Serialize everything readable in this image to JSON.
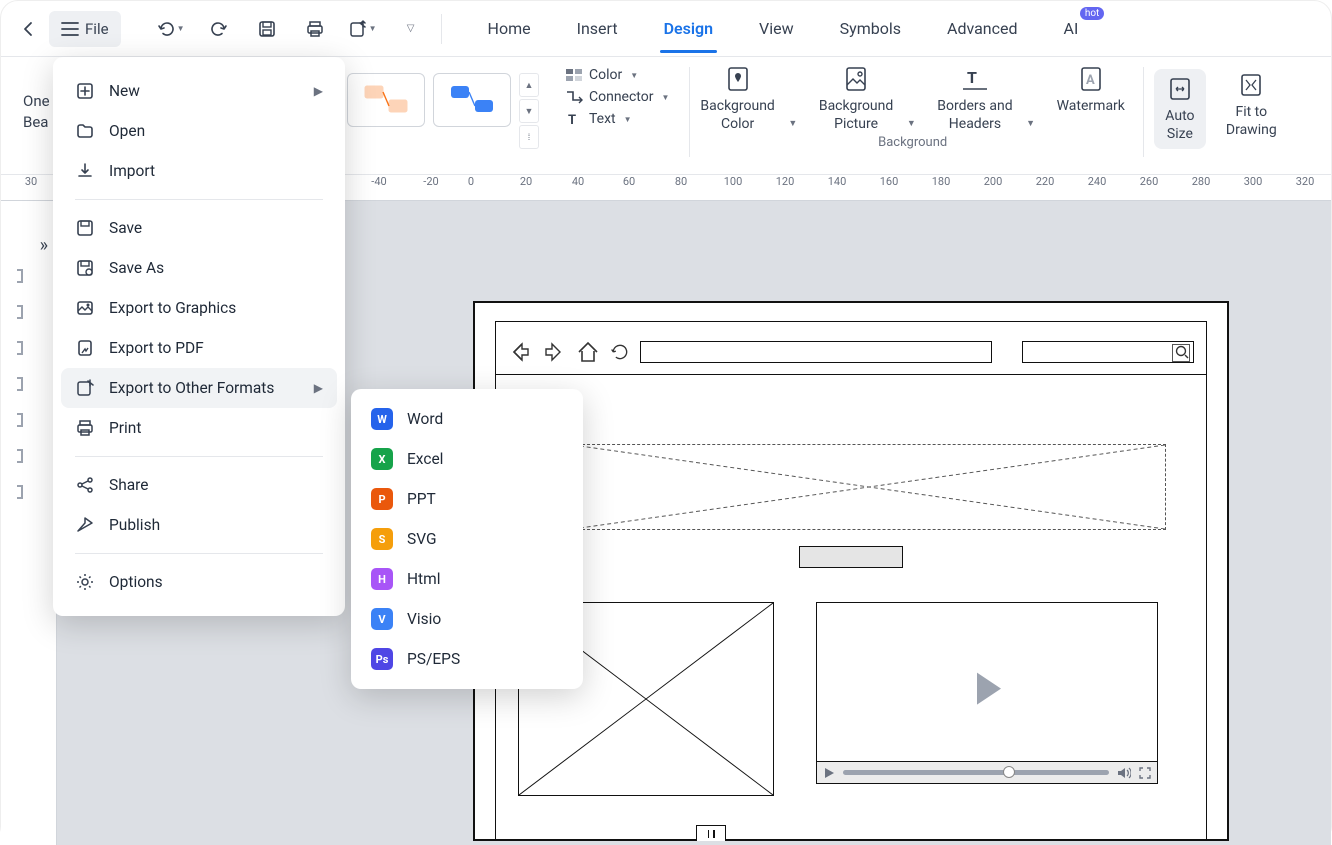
{
  "toolbar": {
    "file_label": "File"
  },
  "tabs": {
    "home": "Home",
    "insert": "Insert",
    "design": "Design",
    "view": "View",
    "symbols": "Symbols",
    "advanced": "Advanced",
    "ai": "AI",
    "ai_badge": "hot"
  },
  "ribbon": {
    "left_hidden_line1": "One",
    "left_hidden_line2": "Bea",
    "color": "Color",
    "connector": "Connector",
    "text": "Text",
    "bg_color": "Background Color",
    "bg_picture": "Background Picture",
    "borders_headers": "Borders and Headers",
    "watermark": "Watermark",
    "bg_group": "Background",
    "auto_size": "Auto Size",
    "fit_drawing": "Fit to Drawing"
  },
  "ruler": [
    "30",
    "",
    "",
    "",
    "",
    "-40",
    "-20",
    "0",
    "20",
    "40",
    "60",
    "80",
    "100",
    "120",
    "140",
    "160",
    "180",
    "200",
    "220",
    "240",
    "260",
    "280",
    "300",
    "320"
  ],
  "file_menu": {
    "new": "New",
    "open": "Open",
    "import": "Import",
    "save": "Save",
    "save_as": "Save As",
    "export_graphics": "Export to Graphics",
    "export_pdf": "Export to PDF",
    "export_other": "Export to Other Formats",
    "print": "Print",
    "share": "Share",
    "publish": "Publish",
    "options": "Options"
  },
  "export_formats": {
    "word": {
      "label": "Word",
      "color": "#2563eb",
      "glyph": "W"
    },
    "excel": {
      "label": "Excel",
      "color": "#16a34a",
      "glyph": "X"
    },
    "ppt": {
      "label": "PPT",
      "color": "#ea580c",
      "glyph": "P"
    },
    "svg": {
      "label": "SVG",
      "color": "#f59e0b",
      "glyph": "S"
    },
    "html": {
      "label": "Html",
      "color": "#a855f7",
      "glyph": "H"
    },
    "visio": {
      "label": "Visio",
      "color": "#3b82f6",
      "glyph": "V"
    },
    "pseps": {
      "label": "PS/EPS",
      "color": "#4f46e5",
      "glyph": "Ps"
    }
  }
}
